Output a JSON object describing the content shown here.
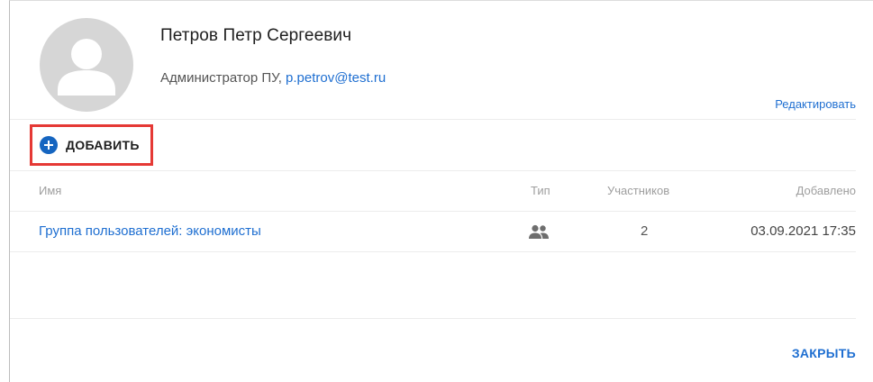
{
  "user": {
    "name": "Петров Петр Сергеевич",
    "role": "Администратор ПУ, ",
    "email": "p.petrov@test.ru"
  },
  "actions": {
    "edit_label": "Редактировать",
    "add_label": "ДОБАВИТЬ",
    "close_label": "ЗАКРЫТЬ"
  },
  "table": {
    "headers": {
      "name": "Имя",
      "type": "Тип",
      "members": "Участников",
      "added": "Добавлено"
    },
    "rows": [
      {
        "name": "Группа пользователей: экономисты",
        "type_icon": "group-icon",
        "members": "2",
        "added": "03.09.2021 17:35"
      }
    ]
  },
  "colors": {
    "accent": "#1f6fd1",
    "add_icon": "#1565c0",
    "highlight_border": "#e53935"
  }
}
